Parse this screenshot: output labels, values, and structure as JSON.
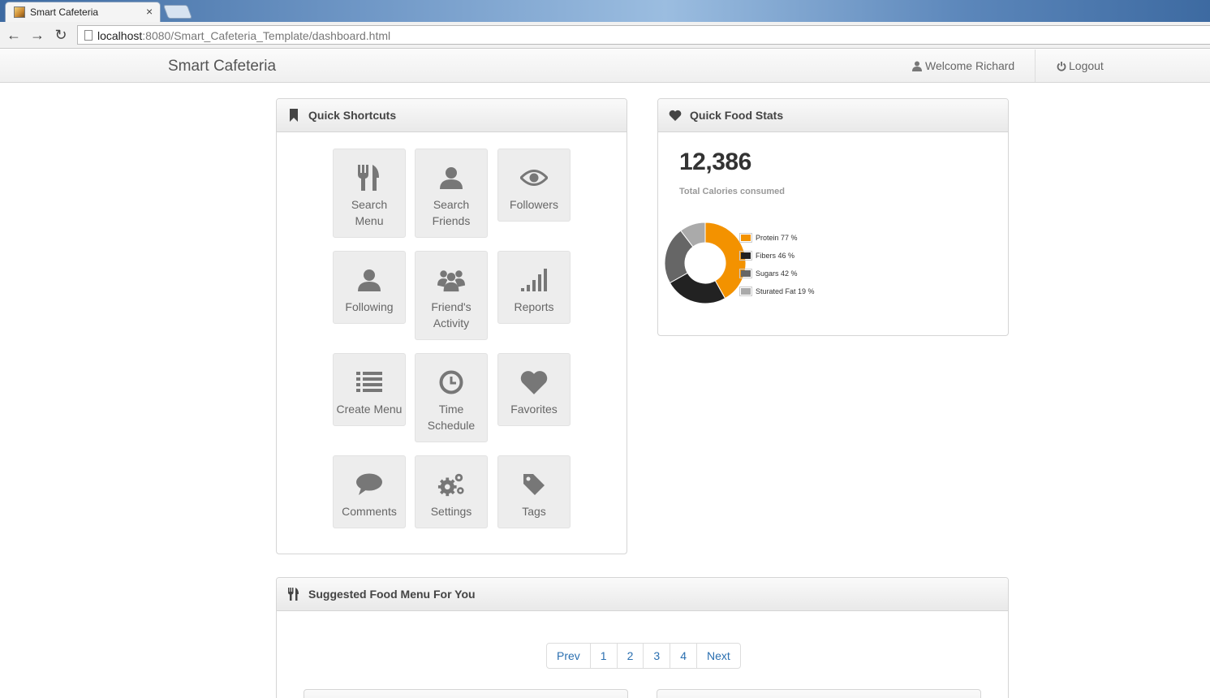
{
  "browser": {
    "tab_title": "Smart Cafeteria",
    "tab_close": "×",
    "url_host": "localhost",
    "url_path": ":8080/Smart_Cafeteria_Template/dashboard.html",
    "back": "←",
    "forward": "→",
    "reload": "↻"
  },
  "navbar": {
    "brand": "Smart Cafeteria",
    "welcome": "Welcome Richard",
    "logout": "Logout"
  },
  "shortcuts": {
    "title": "Quick Shortcuts",
    "items": [
      {
        "label": "Search Menu",
        "icon": "cutlery-icon"
      },
      {
        "label": "Search Friends",
        "icon": "user-icon"
      },
      {
        "label": "Followers",
        "icon": "eye-icon"
      },
      {
        "label": "Following",
        "icon": "user-icon"
      },
      {
        "label": "Friend's Activity",
        "icon": "group-icon"
      },
      {
        "label": "Reports",
        "icon": "signal-icon"
      },
      {
        "label": "Create Menu",
        "icon": "list-icon"
      },
      {
        "label": "Time Schedule",
        "icon": "clock-icon"
      },
      {
        "label": "Favorites",
        "icon": "heart-icon"
      },
      {
        "label": "Comments",
        "icon": "comment-icon"
      },
      {
        "label": "Settings",
        "icon": "cogs-icon"
      },
      {
        "label": "Tags",
        "icon": "tag-icon"
      }
    ]
  },
  "stats": {
    "title": "Quick Food Stats",
    "total_calories": "12,386",
    "total_label": "Total Calories consumed",
    "chart_data": {
      "type": "pie",
      "series": [
        {
          "name": "Protein",
          "label": "Protein 77 %",
          "value": 77,
          "color": "#f39200"
        },
        {
          "name": "Fibers",
          "label": "Fibers 46 %",
          "value": 46,
          "color": "#222222"
        },
        {
          "name": "Sugars",
          "label": "Sugars 42 %",
          "value": 42,
          "color": "#666666"
        },
        {
          "name": "Sturated Fat",
          "label": "Sturated Fat 19 %",
          "value": 19,
          "color": "#aaaaaa"
        }
      ],
      "donut": true,
      "legend": "right"
    }
  },
  "suggested": {
    "title": "Suggested Food Menu For You",
    "pagination": [
      "Prev",
      "1",
      "2",
      "3",
      "4",
      "Next"
    ]
  }
}
